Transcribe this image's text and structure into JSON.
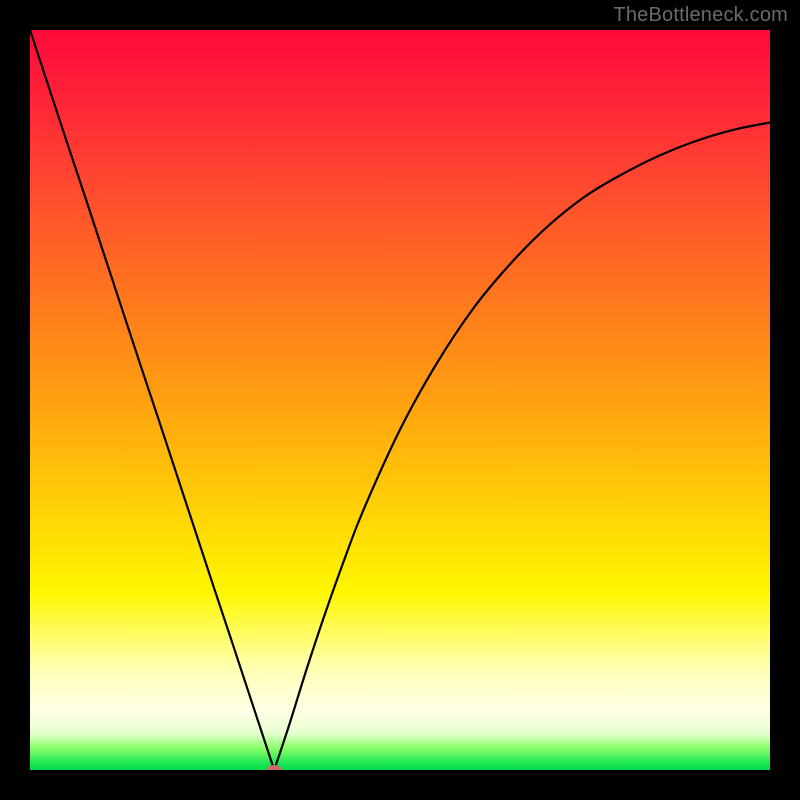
{
  "watermark": "TheBottleneck.com",
  "chart_data": {
    "type": "line",
    "title": "",
    "xlabel": "",
    "ylabel": "",
    "xlim": [
      0,
      100
    ],
    "ylim": [
      0,
      100
    ],
    "grid": false,
    "legend": false,
    "background_gradient": {
      "stops": [
        {
          "pos": 0.0,
          "color": "#ff0a3a",
          "meaning": "high-bottleneck"
        },
        {
          "pos": 0.5,
          "color": "#ffa010"
        },
        {
          "pos": 0.76,
          "color": "#fff700"
        },
        {
          "pos": 0.95,
          "color": "#e6ffd0"
        },
        {
          "pos": 1.0,
          "color": "#00d84a",
          "meaning": "balanced"
        }
      ]
    },
    "series": [
      {
        "name": "bottleneck-curve",
        "x": [
          0.0,
          2.5,
          5.0,
          7.5,
          10.0,
          12.5,
          15.0,
          17.5,
          20.0,
          22.5,
          25.0,
          27.5,
          30.0,
          33.0,
          35.0,
          37.5,
          40.0,
          42.5,
          45.0,
          50.0,
          55.0,
          60.0,
          65.0,
          70.0,
          75.0,
          80.0,
          85.0,
          90.0,
          95.0,
          100.0
        ],
        "y": [
          100,
          92.4,
          84.8,
          77.3,
          69.7,
          62.1,
          54.5,
          47.0,
          39.4,
          31.8,
          24.2,
          16.7,
          9.1,
          0.0,
          6.0,
          14.0,
          21.5,
          28.5,
          35.0,
          46.0,
          55.0,
          62.5,
          68.5,
          73.5,
          77.5,
          80.5,
          83.0,
          85.0,
          86.5,
          87.5
        ]
      }
    ],
    "marker": {
      "name": "optimal-point",
      "x": 33.0,
      "y": 0.0,
      "color": "#cf6a6a"
    }
  }
}
